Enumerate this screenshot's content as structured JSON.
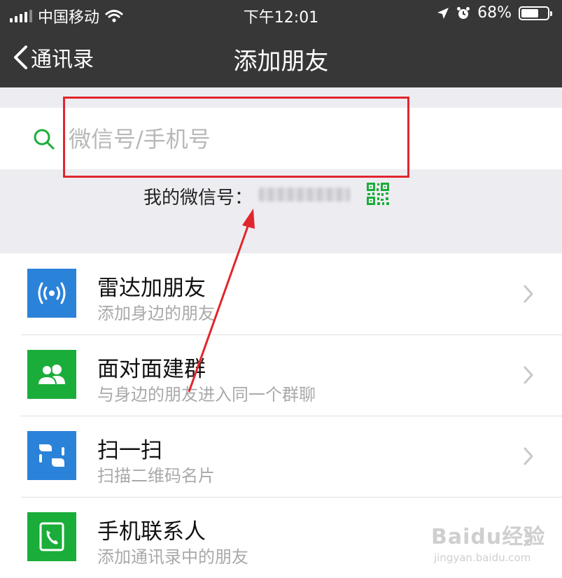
{
  "status_bar": {
    "carrier": "中国移动",
    "time": "下午12:01",
    "battery_percent": "68%",
    "battery_level": 0.68,
    "icons": [
      "signal-bars-icon",
      "wifi-icon",
      "location-arrow-icon",
      "alarm-clock-icon",
      "battery-icon"
    ]
  },
  "nav": {
    "back_label": "通讯录",
    "title": "添加朋友"
  },
  "search": {
    "placeholder": "微信号/手机号",
    "value": ""
  },
  "my_id": {
    "label": "我的微信号：",
    "value": "wxid_hidden"
  },
  "menu": {
    "items": [
      {
        "title": "雷达加朋友",
        "subtitle": "添加身边的朋友",
        "icon": "radar-icon",
        "color": "#2b82d9"
      },
      {
        "title": "面对面建群",
        "subtitle": "与身边的朋友进入同一个群聊",
        "icon": "group-people-icon",
        "color": "#1aad3a"
      },
      {
        "title": "扫一扫",
        "subtitle": "扫描二维码名片",
        "icon": "scan-icon",
        "color": "#2b82d9"
      },
      {
        "title": "手机联系人",
        "subtitle": "添加通讯录中的朋友",
        "icon": "phone-contacts-icon",
        "color": "#1aad3a"
      }
    ]
  },
  "colors": {
    "nav_bg": "#373738",
    "accent_green": "#1aad3a",
    "annotation_red": "#e1262d"
  },
  "watermark": {
    "main": "Baidu经验",
    "url": "jingyan.baidu.com"
  }
}
